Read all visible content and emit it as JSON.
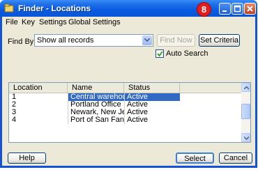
{
  "window": {
    "title": "Finder - Locations",
    "step_badge": "8"
  },
  "menu": {
    "items": [
      "File",
      "Key",
      "Settings",
      "Global Settings"
    ]
  },
  "find": {
    "label": "Find By:",
    "selected_option": "Show all records",
    "find_now_label": "Find Now",
    "set_criteria_label": "Set Criteria",
    "auto_search_label": "Auto Search",
    "auto_search_checked": true
  },
  "grid": {
    "columns": [
      "Location",
      "Name",
      "Status"
    ],
    "rows": [
      [
        "1",
        "Central warehou...",
        "Active"
      ],
      [
        "2",
        "Portland Office",
        "Active"
      ],
      [
        "3",
        "Newark, New Je...",
        "Active"
      ],
      [
        "4",
        "Port of San Fan...",
        "Active"
      ]
    ],
    "selected_row": 0
  },
  "buttons": {
    "help": "Help",
    "select": "Select",
    "cancel": "Cancel"
  },
  "colors": {
    "titlebar": "#0a55d6",
    "selection": "#316ac5",
    "badge": "#e21d1d",
    "client_bg": "#ece9d8"
  }
}
